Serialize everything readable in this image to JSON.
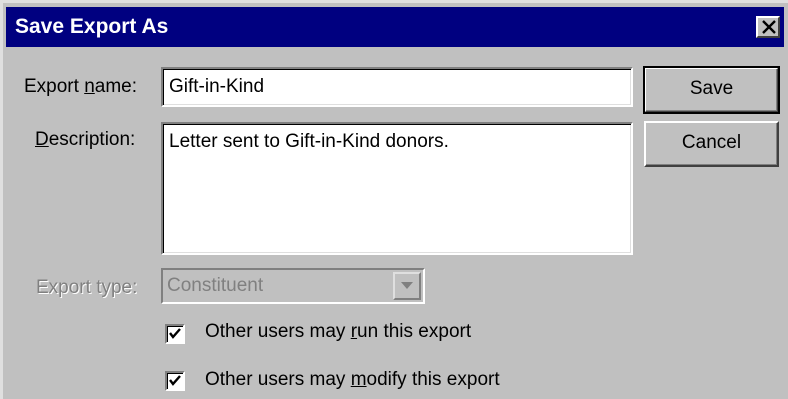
{
  "window": {
    "title": "Save Export As"
  },
  "fields": {
    "export_name": {
      "label_pre": "Export ",
      "label_accel": "n",
      "label_post": "ame:",
      "value": "Gift-in-Kind"
    },
    "description": {
      "label_pre": "",
      "label_accel": "D",
      "label_post": "escription:",
      "value": "Letter sent to Gift-in-Kind donors."
    },
    "export_type": {
      "label": "Export type:",
      "value": "Constituent",
      "disabled": true
    }
  },
  "buttons": {
    "save": "Save",
    "cancel": "Cancel"
  },
  "options": {
    "run": {
      "label_pre": "Other users may ",
      "label_accel": "r",
      "label_post": "un this export",
      "checked": true
    },
    "modify": {
      "label_pre": "Other users may ",
      "label_accel": "m",
      "label_post": "odify this export",
      "checked": true
    }
  }
}
